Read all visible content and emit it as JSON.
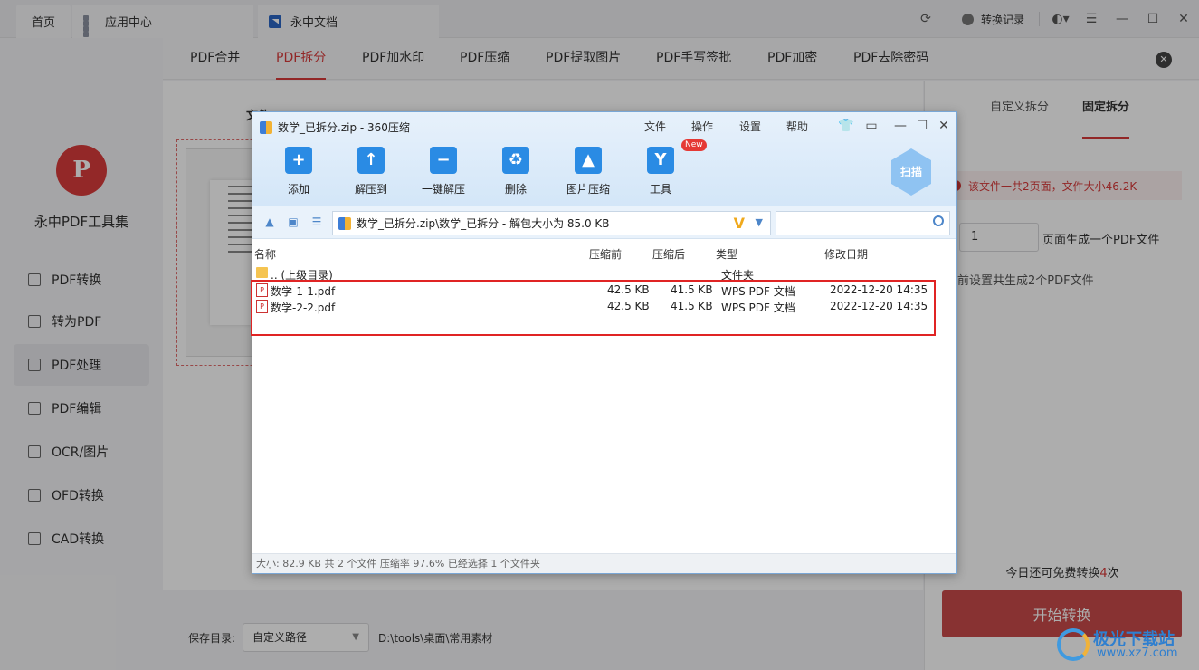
{
  "topbar": {
    "tabs": [
      "首页",
      "应用中心",
      "永中文档"
    ],
    "record_label": "转换记录"
  },
  "sidebar": {
    "logo_letter": "P",
    "app_name": "永中PDF工具集",
    "items": [
      {
        "label": "PDF转换"
      },
      {
        "label": "转为PDF"
      },
      {
        "label": "PDF处理"
      },
      {
        "label": "PDF编辑"
      },
      {
        "label": "OCR/图片"
      },
      {
        "label": "OFD转换"
      },
      {
        "label": "CAD转换"
      }
    ],
    "active_item": "PDF处理"
  },
  "function_tabs": [
    "PDF合并",
    "PDF拆分",
    "PDF加水印",
    "PDF压缩",
    "PDF提取图片",
    "PDF手写签批",
    "PDF加密",
    "PDF去除密码"
  ],
  "active_function": "PDF拆分",
  "main": {
    "partial_title": "文件"
  },
  "bottom": {
    "save_label": "保存目录:",
    "save_select": "自定义路径",
    "save_path": "D:\\tools\\桌面\\常用素材"
  },
  "right_panel": {
    "tabs": [
      "自定义拆分",
      "固定拆分"
    ],
    "active_tab": "固定拆分",
    "warning": "该文件一共2页面，文件大小46.2K",
    "pages_value": "1",
    "pages_suffix": "页面生成一个PDF文件",
    "note": "前设置共生成2个PDF文件",
    "free_prefix": "今日还可免费转换",
    "free_count": "4",
    "free_suffix": "次",
    "start_button": "开始转换"
  },
  "dialog": {
    "title": "数学_已拆分.zip - 360压缩",
    "menu": [
      "文件",
      "操作",
      "设置",
      "帮助"
    ],
    "tools": [
      {
        "label": "添加",
        "icon": "add-icon"
      },
      {
        "label": "解压到",
        "icon": "extract-to-icon"
      },
      {
        "label": "一键解压",
        "icon": "one-click-extract-icon"
      },
      {
        "label": "删除",
        "icon": "delete-icon"
      },
      {
        "label": "图片压缩",
        "icon": "image-compress-icon"
      },
      {
        "label": "工具",
        "icon": "tools-icon",
        "badge": "New"
      }
    ],
    "scan_label": "扫描",
    "path": "数学_已拆分.zip\\数学_已拆分 - 解包大小为 85.0 KB",
    "columns": [
      "名称",
      "压缩前",
      "压缩后",
      "类型",
      "修改日期"
    ],
    "parent_row": {
      "name": ".. (上级目录)",
      "type": "文件夹"
    },
    "files": [
      {
        "name": "数学-1-1.pdf",
        "before": "42.5 KB",
        "after": "41.5 KB",
        "type": "WPS PDF 文档",
        "date": "2022-12-20 14:35"
      },
      {
        "name": "数学-2-2.pdf",
        "before": "42.5 KB",
        "after": "41.5 KB",
        "type": "WPS PDF 文档",
        "date": "2022-12-20 14:35"
      }
    ],
    "status": "大小: 82.9 KB 共 2 个文件 压缩率 97.6% 已经选择 1 个文件夹"
  },
  "watermark": {
    "title": "极光下载站",
    "url": "www.xz7.com"
  }
}
